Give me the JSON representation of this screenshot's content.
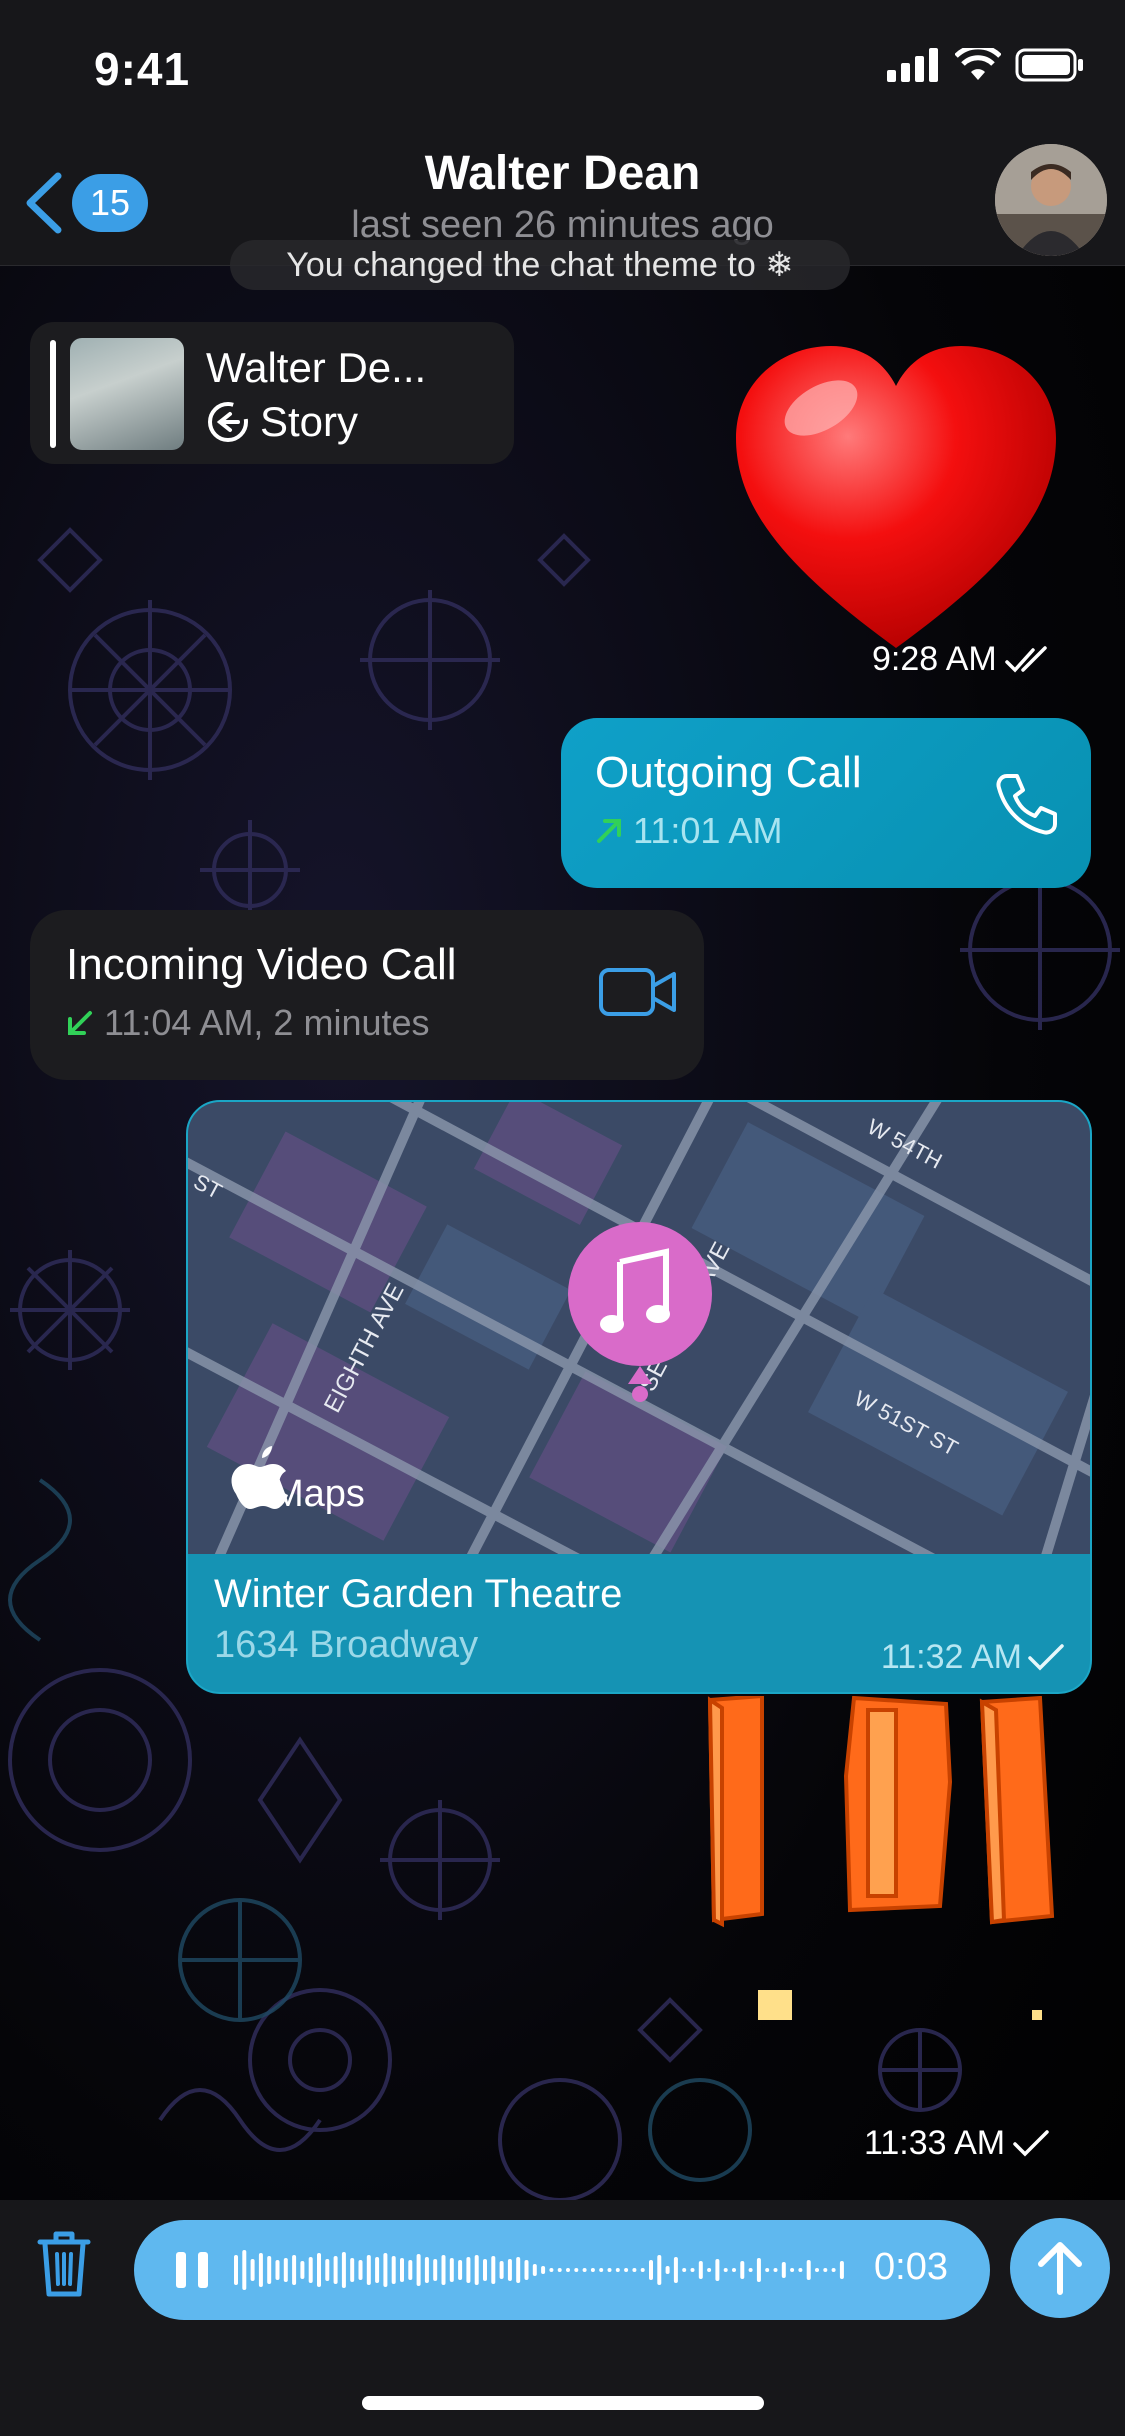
{
  "status_bar": {
    "time": "9:41"
  },
  "nav": {
    "back_badge": "15",
    "contact_name": "Walter Dean",
    "last_seen": "last seen 26 minutes ago"
  },
  "messages": {
    "system_notice": "You changed the chat theme to ❄",
    "story_reply": {
      "name": "Walter De...",
      "label": "Story"
    },
    "heart_time": "9:28 AM",
    "outgoing_call": {
      "title": "Outgoing Call",
      "time": "11:01 AM"
    },
    "incoming_video_call": {
      "title": "Incoming Video Call",
      "detail": "11:04 AM, 2 minutes"
    },
    "location": {
      "map_brand": "Maps",
      "streets": [
        "W 54TH",
        "ST",
        "EIGHTH AVE",
        "SEVENTH AVE",
        "W 51ST ST"
      ],
      "place": "Winter Garden Theatre",
      "address": "1634 Broadway",
      "time": "11:32 AM"
    },
    "sticker_time": "11:33 AM"
  },
  "input_bar": {
    "duration": "0:03"
  },
  "colors": {
    "accent": "#3b9ee6",
    "outgoing_bubble": "#0fa0c8",
    "incoming_bubble": "#1c1c1f",
    "pin": "#d96bc9"
  }
}
